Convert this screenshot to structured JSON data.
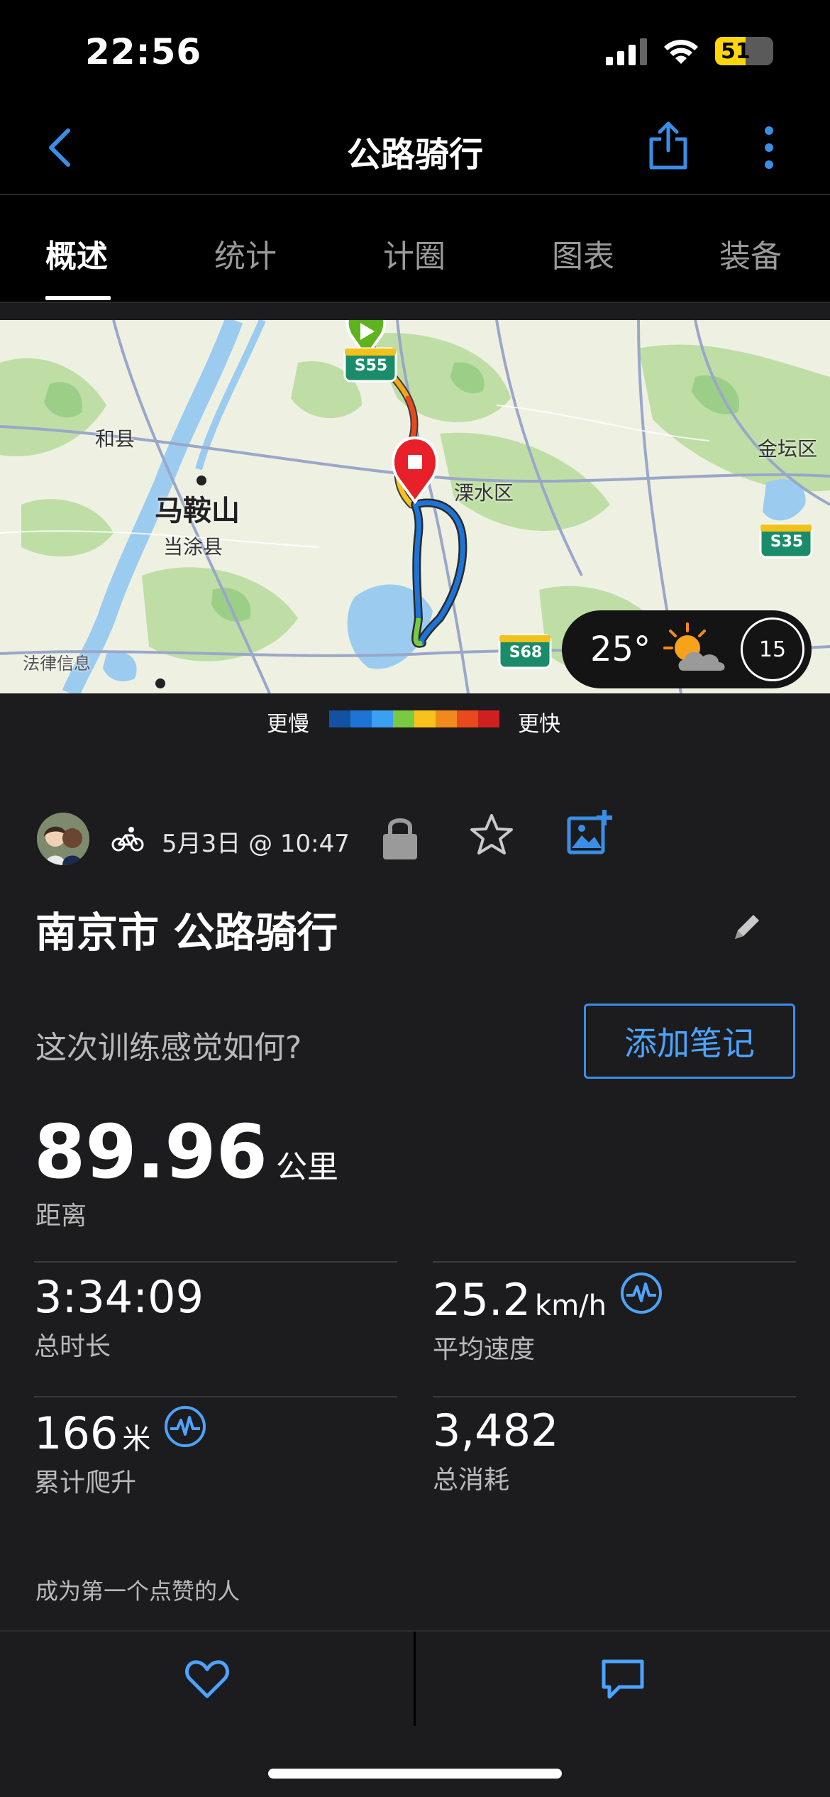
{
  "status": {
    "time": "22:56",
    "battery": "51"
  },
  "nav": {
    "title": "公路骑行"
  },
  "tabs": [
    {
      "label": "概述",
      "active": true
    },
    {
      "label": "统计"
    },
    {
      "label": "计圈"
    },
    {
      "label": "图表"
    },
    {
      "label": "装备"
    }
  ],
  "map": {
    "labels": {
      "hexian": "和县",
      "maanshan": "马鞍山",
      "dangtu": "当涂县",
      "lishui": "溧水区",
      "jintan": "金坛区",
      "legal": "法律信息"
    },
    "road_badges": {
      "s55": "S55",
      "s35": "S35",
      "s68": "S68"
    },
    "weather": {
      "temperature": "25°",
      "wind": "15"
    }
  },
  "speed_legend": {
    "slow": "更慢",
    "fast": "更快",
    "colors": [
      "#1251a3",
      "#1e74d6",
      "#3aa0f0",
      "#7ac943",
      "#f7c21b",
      "#f28a1b",
      "#e8491d",
      "#d01f1f"
    ]
  },
  "activity": {
    "date": "5月3日 @ 10:47",
    "title": "南京市 公路骑行",
    "feel_prompt": "这次训练感觉如何?",
    "add_note": "添加笔记",
    "distance": {
      "value": "89.96",
      "unit": "公里",
      "label": "距离"
    },
    "stats": {
      "duration": {
        "value": "3:34:09",
        "label": "总时长"
      },
      "avg_speed": {
        "value": "25.2",
        "unit": "km/h",
        "label": "平均速度"
      },
      "elevation": {
        "value": "166",
        "unit": "米",
        "label": "累计爬升"
      },
      "calories": {
        "value": "3,482",
        "label": "总消耗"
      }
    },
    "likes_text": "成为第一个点赞的人"
  },
  "colors": {
    "accent": "#4da3ff",
    "background": "#1c1c1e"
  }
}
